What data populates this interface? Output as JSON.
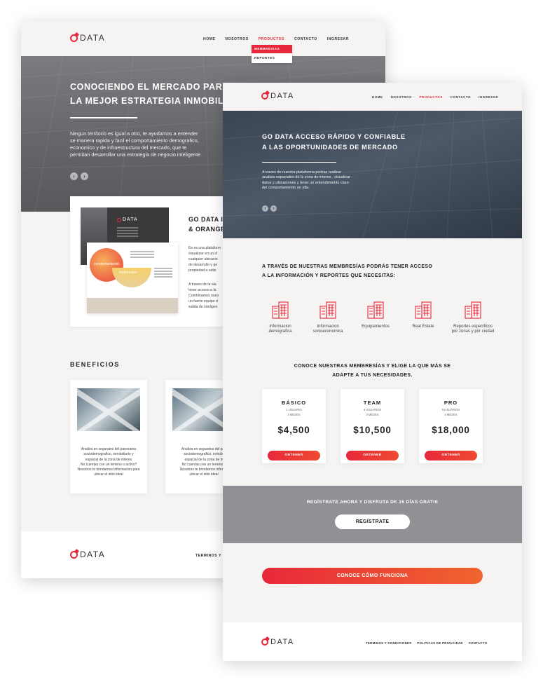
{
  "brand": {
    "logo_text": "DATA",
    "accent": "#e8283a",
    "gradient_end": "#f0652e"
  },
  "page_a": {
    "nav": {
      "items": [
        "HOME",
        "NOSOTROS",
        "PRODUCTOS",
        "CONTACTO",
        "INGRESAR"
      ],
      "active": "PRODUCTOS"
    },
    "dropdown": {
      "items": [
        "MEMBRESIAS",
        "REPORTES"
      ]
    },
    "hero": {
      "title_line1": "CONOCIENDO EL MERCADO PARA C",
      "title_line2": "LA MEJOR ESTRATEGIA INMOBILIA",
      "body_line1": "Ningun territorio es igual a otro, te ayudamos a entender",
      "body_line2": "se manera rapida y facil el comportamiento demografico,",
      "body_line3": "economico y de infraestructura del mercado, que te",
      "body_line4": "permitan desarrollar una estrategia de negocio inteligente"
    },
    "product": {
      "title_line1": "GO DATA I",
      "title_line2": "& ORANGE",
      "card_label": "DATA",
      "circle_label": "comportamiento",
      "semi_label": "exploracion",
      "p1": [
        "Es es una plataform",
        "visualizar en un cl",
        "cualquier ubicacio",
        "de desarrollo y ge",
        "propiedad a satis"
      ],
      "p2": [
        "A traves de la ala",
        "tener acceso a la",
        "Combinamos nues",
        "un fuerte equipo d",
        "salida de inteligen"
      ]
    },
    "benefits": {
      "title": "BENEFICIOS",
      "card1": [
        "Analiza en segundos del panorama",
        "sociodemografico, inmobiliario y",
        "espacial de la zona de interes",
        "No cuentas con un terreno o activo?",
        "Nosotros te brindamos informacion para",
        "ubicar el sitio ideal"
      ],
      "card2": [
        "Analiza en segundos del pan",
        "sociodemografico, inmobil",
        "espacial de la zona de in",
        "No cuentas con un terreno o",
        "Nosotros te brindamos informa",
        "ubicar el sitio ideal"
      ]
    },
    "footer": {
      "logo_text": "DATA",
      "link": "TERMINOS Y C"
    }
  },
  "page_b": {
    "nav": {
      "items": [
        "HOME",
        "NOSOTROS",
        "PRODUCTOS",
        "CONTACTO",
        "INGRESAR"
      ],
      "active": "PRODUCTOS"
    },
    "hero": {
      "title_line1": "GO DATA ACCESO RÁPIDO Y CONFIABLE",
      "title_line2": "A LAS OPORTUNIDADES DE MERCADO",
      "body_line1": "A traves de nuestra plataforma podras realizar",
      "body_line2": "analisis espaciales de la zona de interes , visualizar",
      "body_line3": "datos y ubicaciones y tener un entendimiento claro",
      "body_line4": "del comportamiento en ella."
    },
    "intro": {
      "line1": "A TRAVÉS DE NUESTRAS MEMBRESÍAS PODRÁS TENER ACCESO",
      "line2": "A LA INFORMACIÓN Y REPORTES QUE NECESITAS:"
    },
    "features": [
      {
        "line1": "Informacion",
        "line2": "demografica",
        "icon": "building-icon"
      },
      {
        "line1": "Informacion",
        "line2": "socioeconomica",
        "icon": "building-icon"
      },
      {
        "line1": "Equipamientos",
        "line2": "",
        "icon": "building-icon"
      },
      {
        "line1": "Real Estate",
        "line2": "",
        "icon": "building-icon"
      },
      {
        "line1": "Reportes especificos",
        "line2": "por zonas y por ciudad",
        "icon": "building-icon"
      }
    ],
    "memberships": {
      "line1": "CONOCE NUESTRAS MEMBRESÍAS Y ELIGE LA QUE MÁS SE",
      "line2": "ADAPTE A TUS NECESIDADES.",
      "plans": [
        {
          "name": "BÁSICO",
          "users": "1 USUARIO",
          "months": "3 MESES",
          "price": "$4,500",
          "button": "OBTENER"
        },
        {
          "name": "TEAM",
          "users": "4 USUARIOS",
          "months": "3 MESES",
          "price": "$10,500",
          "button": "OBTENER"
        },
        {
          "name": "PRO",
          "users": "6 USUARIOS",
          "months": "4 MESES",
          "price": "$18,000",
          "button": "OBTENER"
        }
      ]
    },
    "trial": {
      "text": "REGÍSTRATE AHORA Y DISFRUTA DE 15 DÍAS GRATIS",
      "button": "REGÍSTRATE"
    },
    "cta": "CONOCE CÓMO FUNCIONA",
    "footer": {
      "logo_text": "DATA",
      "links": [
        "TERMINOS Y CONDICIONES",
        "POLITICAS DE PRIVACIDAD",
        "CONTACTO"
      ]
    }
  }
}
